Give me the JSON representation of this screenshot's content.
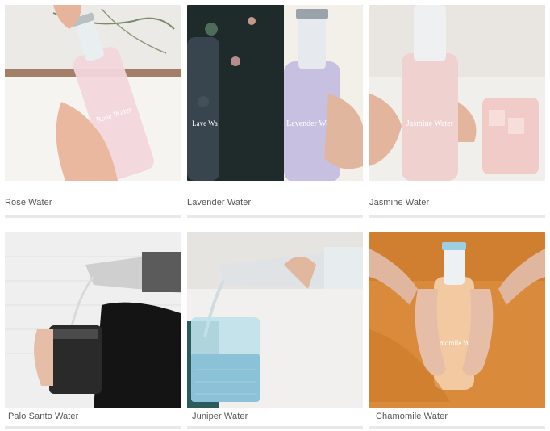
{
  "products": [
    {
      "name": "Rose Water",
      "bottle_text": "Rose Water",
      "image_label": "rose-water-image"
    },
    {
      "name": "Lavender Water",
      "bottle_text": "Lavender Water",
      "image_label": "lavender-water-image"
    },
    {
      "name": "Jasmine Water",
      "bottle_text": "Jasmine Water",
      "image_label": "jasmine-water-image"
    },
    {
      "name": "Palo Santo Water",
      "bottle_text": "",
      "image_label": "palo-santo-water-image"
    },
    {
      "name": "Juniper Water",
      "bottle_text": "",
      "image_label": "juniper-water-image"
    },
    {
      "name": "Chamomile Water",
      "bottle_text": "Chamomile Water",
      "image_label": "chamomile-water-image"
    }
  ],
  "colors": {
    "label_text": "#555555",
    "divider": "#e9e9e9"
  }
}
